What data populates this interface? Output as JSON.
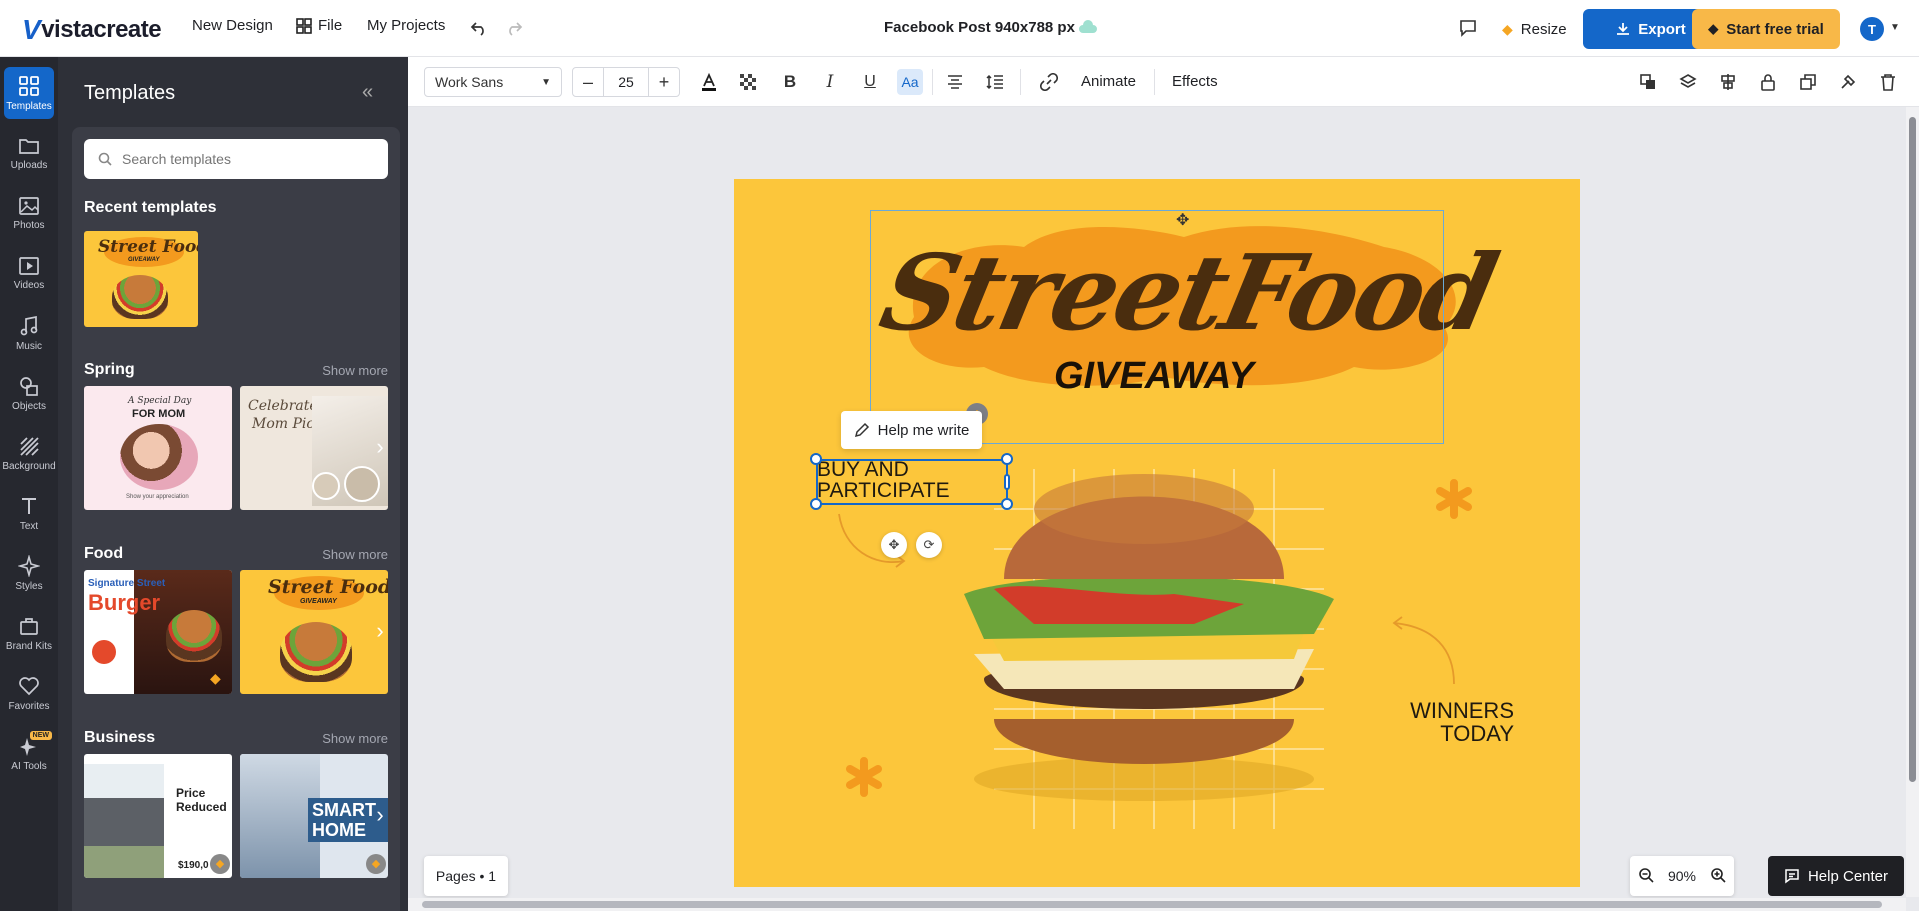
{
  "header": {
    "logo": "vistacreate",
    "new_design": "New Design",
    "file": "File",
    "my_projects": "My Projects",
    "doc_title": "Facebook Post 940x788 px",
    "resize": "Resize",
    "export": "Export",
    "start_trial": "Start free trial",
    "avatar_initial": "T"
  },
  "rail": {
    "items": [
      {
        "label": "Templates",
        "icon": "templates-icon"
      },
      {
        "label": "Uploads",
        "icon": "folder-icon"
      },
      {
        "label": "Photos",
        "icon": "photo-icon"
      },
      {
        "label": "Videos",
        "icon": "video-icon"
      },
      {
        "label": "Music",
        "icon": "music-icon"
      },
      {
        "label": "Objects",
        "icon": "objects-icon"
      },
      {
        "label": "Background",
        "icon": "background-icon"
      },
      {
        "label": "Text",
        "icon": "text-icon"
      },
      {
        "label": "Styles",
        "icon": "styles-icon"
      },
      {
        "label": "Brand Kits",
        "icon": "brand-kit-icon"
      },
      {
        "label": "Favorites",
        "icon": "heart-icon"
      },
      {
        "label": "AI Tools",
        "icon": "ai-sparkle-icon"
      }
    ],
    "new_badge": "NEW"
  },
  "panel": {
    "title": "Templates",
    "search_placeholder": "Search templates",
    "recent_title": "Recent templates",
    "sections": [
      {
        "title": "Spring",
        "show_more": "Show more"
      },
      {
        "title": "Food",
        "show_more": "Show more"
      },
      {
        "title": "Business",
        "show_more": "Show more"
      }
    ],
    "thumb_texts": {
      "recent_street": "Street Food",
      "recent_give": "GIVEAWAY",
      "spring1_line1": "A Special Day",
      "spring1_line2": "FOR MOM",
      "spring1_footer": "Show your appreciation",
      "spring2_line1": "Celebrate",
      "spring2_line2": "Mom Picks",
      "food1_line1": "Signature Street",
      "food1_line2": "Burger",
      "food2_street": "Street Food",
      "food2_give": "GIVEAWAY",
      "biz1_line1": "Price",
      "biz1_line2": "Reduced",
      "biz1_price": "$190,0",
      "biz2_line1": "SMART",
      "biz2_line2": "HOME"
    }
  },
  "toolbar": {
    "font": "Work Sans",
    "font_size": "25",
    "animate": "Animate",
    "effects": "Effects"
  },
  "canvas": {
    "title_main": "StreetFood",
    "title_sub": "GIVEAWAY",
    "text_box_line1": "BUY AND",
    "text_box_line2": "PARTICIPATE",
    "winners_line1": "WINNERS",
    "winners_line2": "TODAY",
    "help_me_write": "Help me write"
  },
  "bottom": {
    "pages": "Pages • 1",
    "zoom": "90%",
    "help_center": "Help Center"
  },
  "colors": {
    "accent": "#1467c9",
    "trial": "#f8b848",
    "canvas_bg": "#fcc63b",
    "splash": "#f39a1e"
  }
}
